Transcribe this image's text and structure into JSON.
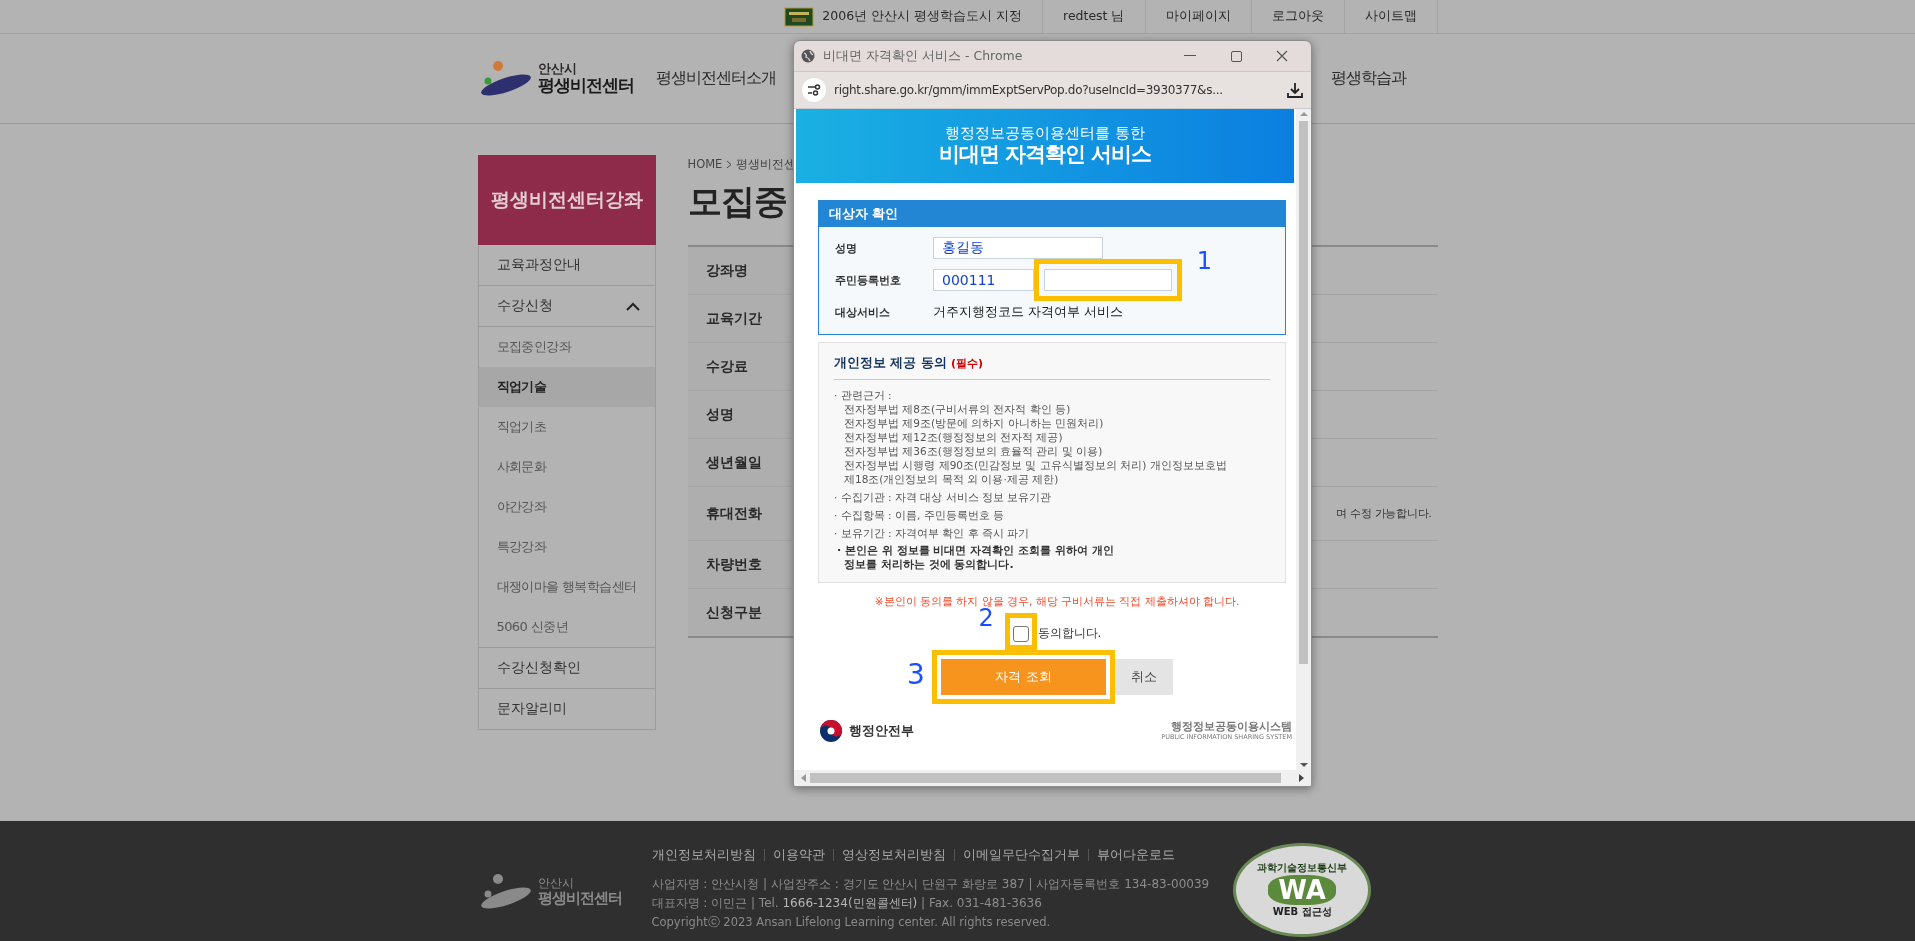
{
  "top_bar": {
    "badge": "2006년 안산시 평생학습도시 지정",
    "links": [
      "redtest 님",
      "마이페이지",
      "로그아웃",
      "사이트맵"
    ]
  },
  "header": {
    "logo": {
      "city": "안산시",
      "name": "평생비전센터"
    },
    "nav": [
      "평생비전센터소개",
      "평생학습과"
    ]
  },
  "sidebar": {
    "title": "평생비전센터강좌",
    "items": [
      {
        "label": "교육과정안내"
      },
      {
        "label": "수강신청",
        "expanded": true,
        "children": [
          {
            "label": "모집중인강좌",
            "selected": false
          },
          {
            "label": "직업기술",
            "selected": true
          },
          {
            "label": "직업기초",
            "selected": false
          },
          {
            "label": "사회문화",
            "selected": false
          },
          {
            "label": "야간강좌",
            "selected": false
          },
          {
            "label": "특강강좌",
            "selected": false
          },
          {
            "label": "대쟁이마을 행복학습센터",
            "selected": false
          },
          {
            "label": "5060 신중년",
            "selected": false
          }
        ]
      },
      {
        "label": "수강신청확인"
      },
      {
        "label": "문자알리미"
      }
    ]
  },
  "main": {
    "breadcrumb": [
      "HOME",
      "평생비전센"
    ],
    "title": "모집중",
    "rows": [
      {
        "label": "강좌명"
      },
      {
        "label": "교육기간"
      },
      {
        "label": "수강료"
      },
      {
        "label": "성명"
      },
      {
        "label": "생년월일"
      },
      {
        "label": "휴대전화",
        "note": "며 수정 가능합니다."
      },
      {
        "label": "차량번호"
      },
      {
        "label": "신청구분"
      }
    ]
  },
  "popup": {
    "window_title": "비대면 자격확인 서비스 - Chrome",
    "url": "right.share.go.kr/gmm/immExptServPop.do?useIncId=3930377&s...",
    "banner": {
      "line1": "행정정보공동이용센터를 통한",
      "line2": "비대면 자격확인 서비스"
    },
    "target_box": {
      "title": "대상자 확인",
      "fields": [
        {
          "kind": "input",
          "label": "성명",
          "value": "홍길동"
        },
        {
          "kind": "split",
          "label": "주민등록번호",
          "value": "000111",
          "marker": "1"
        },
        {
          "kind": "text",
          "label": "대상서비스",
          "value": "거주지행정코드 자격여부 서비스"
        }
      ]
    },
    "consent": {
      "title": "개인정보 제공 동의",
      "required": "(필수)",
      "items": [
        {
          "kind": "basis",
          "label": "· 관련근거 :",
          "lines": [
            "전자정부법 제8조(구비서류의 전자적 확인 등)",
            "전자정부법 제9조(방문에 의하지 아니하는 민원처리)",
            "전자정부법 제12조(행정정보의 전자적 제공)",
            "전자정부법 제36조(행정정보의 효율적 관리 및 이용)",
            "전자정부법 시행령 제90조(민감정보 및 고유식별정보의 처리) 개인정보보호법",
            "제18조(개인정보의 목적 외 이용·제공 제한)"
          ]
        },
        {
          "kind": "plain",
          "text": "· 수집기관 : 자격 대상 서비스 정보 보유기관"
        },
        {
          "kind": "plain",
          "text": "· 수집항목 : 이름, 주민등록번호 등"
        },
        {
          "kind": "plain",
          "text": "· 보유기간 : 자격여부 확인 후 즉시 파기"
        },
        {
          "kind": "strong",
          "text": "· 본인은 위 정보를 비대면 자격확인 조회를 위하여 개인정보를 처리하는 것에 동의합니다."
        }
      ]
    },
    "notice": "※본인이 동의를 하지 않을 경우, 해당 구비서류는 직접 제출하셔야 합니다.",
    "agree": {
      "label": "동의합니다.",
      "checked": false,
      "marker": "2"
    },
    "buttons": [
      {
        "kind": "primary",
        "label": "자격 조회",
        "marker": "3"
      },
      {
        "kind": "secondary",
        "label": "취소"
      }
    ],
    "logos": {
      "ministry": "행정안전부",
      "system": "행정정보공동이용시스템",
      "system_en": "PUBLIC INFORMATION SHARING SYSTEM"
    }
  },
  "footer": {
    "logo": {
      "city": "안산시",
      "name": "평생비전센터"
    },
    "links": [
      "개인정보처리방침",
      "이용약관",
      "영상정보처리방침",
      "이메일무단수집거부",
      "뷰어다운로드"
    ],
    "info": [
      "사업자명 : 안산시청 | 사업장주소 : 경기도 안산시 단원구 화랑로 387 | 사업자등록번호 134-83-00039",
      "대표자명 : 이민근 | Tel. **1666-1234(민원콜센터)** | Fax. 031-481-3636"
    ],
    "copyright": "Copyrightⓒ 2023 Ansan Lifelong Learning center. All rights reserved.",
    "badge": {
      "arc": "과학기술정보통신부",
      "mark": "WA",
      "caption": "WEB 접근성"
    }
  }
}
